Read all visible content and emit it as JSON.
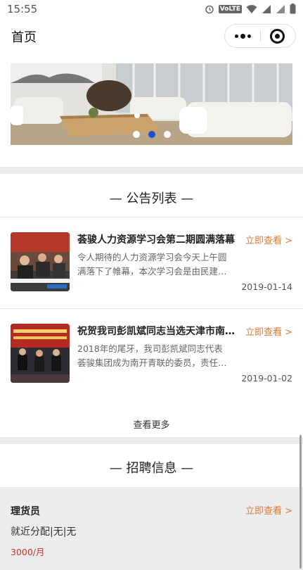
{
  "status_bar": {
    "time": "15:55",
    "network_badge": "VoLTE"
  },
  "nav": {
    "title": "首页"
  },
  "banner": {
    "slide_count": 3,
    "active_index": 1
  },
  "notices": {
    "heading": "— 公告列表 —",
    "items": [
      {
        "title": "荟骏人力资源学习会第二期圆满落幕",
        "summary": "令人期待的人力资源学习会今天上午圆满落下了帷幕，本次学习会是由民建…",
        "date": "2019-01-14",
        "view_label": "立即查看 >"
      },
      {
        "title": "祝贺我司彭凯斌同志当选天津市南开区青联委员",
        "summary": "2018年的尾牙，我司彭凯斌同志代表荟骏集团成为南开青联的委员，责任…",
        "date": "2019-01-02",
        "view_label": "立即查看 >"
      }
    ],
    "see_more": "查看更多"
  },
  "jobs": {
    "heading": "— 招聘信息 —",
    "items": [
      {
        "name": "理货员",
        "info": "就近分配|无|无",
        "salary": "3000/月",
        "view_label": "立即查看 >"
      }
    ]
  },
  "colors": {
    "accent": "#e07a36",
    "salary": "#c0392b",
    "dot_active": "#1a4fd6"
  }
}
